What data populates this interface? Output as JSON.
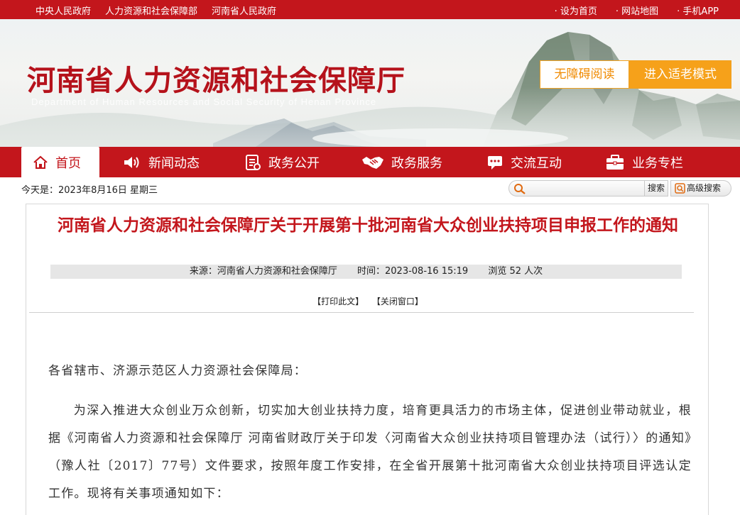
{
  "topbar": {
    "left_links": [
      "中央人民政府",
      "人力资源和社会保障部",
      "河南省人民政府"
    ],
    "right_links": [
      "· 设为首页",
      "· 网站地图",
      "· 手机APP"
    ]
  },
  "banner": {
    "title": "河南省人力资源和社会保障厅",
    "subtitle": "Department of Human Resources and Social Security of Henan Province",
    "accessible_label": "无障碍阅读",
    "elder_label": "进入适老模式"
  },
  "nav": {
    "items": [
      {
        "label": "首页",
        "icon": "home-icon"
      },
      {
        "label": "新闻动态",
        "icon": "speaker-icon"
      },
      {
        "label": "政务公开",
        "icon": "document-icon"
      },
      {
        "label": "政务服务",
        "icon": "handshake-icon"
      },
      {
        "label": "交流互动",
        "icon": "chat-icon"
      },
      {
        "label": "业务专栏",
        "icon": "briefcase-icon"
      }
    ]
  },
  "date_text": "今天是：2023年8月16日 星期三",
  "search": {
    "value": "",
    "placeholder": "",
    "button_label": "搜索",
    "advanced_label": "高级搜索"
  },
  "article": {
    "title": "河南省人力资源和社会保障厅关于开展第十批河南省大众创业扶持项目申报工作的通知",
    "source": "来源：河南省人力资源和社会保障厅",
    "time": "时间：2023-08-16 15:19",
    "views": "浏览 52 人次",
    "print_label": "【打印此文】",
    "close_label": "【关闭窗口】",
    "greeting": "各省辖市、济源示范区人力资源社会保障局：",
    "paragraph": "为深入推进大众创业万众创新，切实加大创业扶持力度，培育更具活力的市场主体，促进创业带动就业，根据《河南省人力资源和社会保障厅 河南省财政厅关于印发〈河南省大众创业扶持项目管理办法（试行）〉的通知》（豫人社〔2017〕77号）文件要求，按照年度工作安排，在全省开展第十批河南省大众创业扶持项目评选认定工作。现将有关事项通知如下："
  },
  "colors": {
    "brand_red": "#c3161c",
    "accent_orange": "#f6a11a"
  }
}
